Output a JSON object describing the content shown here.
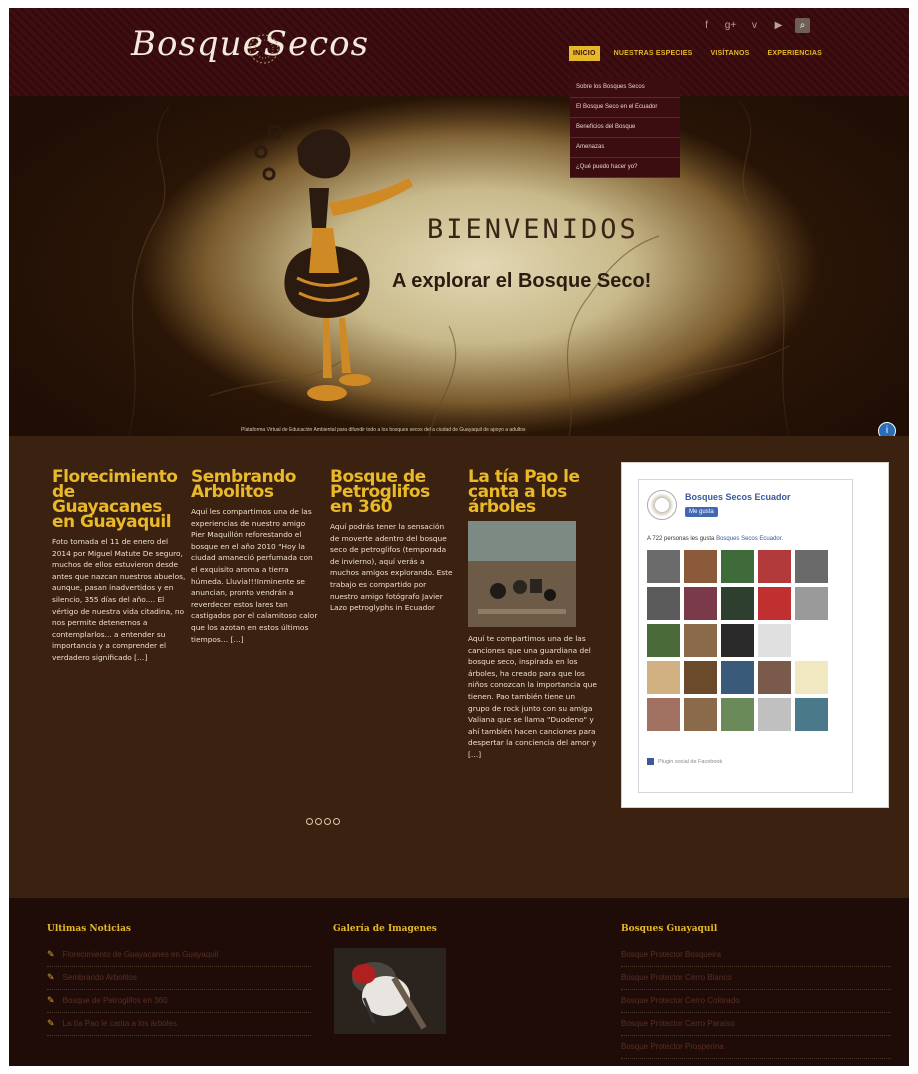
{
  "header": {
    "logo": "BosqueSecos",
    "social_icons": [
      "facebook-icon",
      "google-plus-icon",
      "vimeo-icon",
      "youtube-icon",
      "search-icon"
    ],
    "nav": [
      {
        "label": "INICIO",
        "active": true
      },
      {
        "label": "NUESTRAS ESPECIES",
        "active": false
      },
      {
        "label": "VISÍTANOS",
        "active": false
      },
      {
        "label": "EXPERIENCIAS",
        "active": false
      }
    ],
    "dropdown": [
      "Sobre los Bosques Secos",
      "El Bosque Seco en el Ecuador",
      "Beneficios del Bosque",
      "Amenazas",
      "¿Qué puedo hacer yo?"
    ]
  },
  "hero": {
    "title": "BIENVENIDOS",
    "subtitle": "A explorar el Bosque Seco!",
    "caption": "Plataforma Virtual de Educación Ambiental para difundir todo a los bosques secos del a ciudad de Guayaquil de apoyo a adultos"
  },
  "posts": [
    {
      "title": "Florecimiento de Guayacanes en Guayaquil",
      "body": "Foto tomada el 11 de enero del 2014 por Miguel Matute De seguro, muchos de ellos estuvieron desde antes que nazcan nuestros abuelos, aunque, pasan inadvertidos y en silencio, 355 días del año.... El vértigo de nuestra vida citadina, no nos permite detenernos a contemplarlos... a entender su importancia y a comprender el verdadero significado […]"
    },
    {
      "title": "Sembrando Arbolitos",
      "body": "Aquí les compartimos una de las experiencias de nuestro amigo Pier Maquillón reforestando el bosque en el año 2010 \"Hoy la ciudad amaneció perfumada con el exquisito aroma a tierra húmeda. Lluvia!!!Inminente se anuncian, pronto vendrán a reverdecer estos lares tan castigados por el calamitoso calor que los azotan en estos últimos tiempos… […]"
    },
    {
      "title": "Bosque de Petroglifos en 360",
      "body": "Aquí podrás tener la sensación de moverte adentro del bosque seco de petroglifos (temporada de invierno), aquí verás a muchos amigos explorando. Este trabajo es compartido por nuestro amigo fotógrafo Javier Lazo petroglyphs in Ecuador"
    },
    {
      "title": "La tía Pao le canta a los árboles",
      "body": "Aquí te compartimos una de las canciones que una guardiana del bosque seco, inspirada en los árboles, ha creado para que los niños conozcan la importancia que tienen. Pao también tiene un grupo de rock junto con su amiga Valiana que se llama \"Duodeno\" y ahí también hacen canciones para despertar la conciencia del amor y […]"
    }
  ],
  "facebook": {
    "page_name": "Bosques Secos Ecuador",
    "like_label": "Me gusta",
    "count_text": "A 722 personas les gusta",
    "count_link": "Bosques Secos Ecuador.",
    "plugin_label": "Plugin social de Facebook",
    "thumb_colors": [
      "#6b6b6b",
      "#8a5a3a",
      "#3f6b3a",
      "#b23a3a",
      "#6a6a6a",
      "#5a5a5a",
      "#7a3a4a",
      "#2f3f2f",
      "#c03030",
      "#9a9a9a",
      "#4a6a3a",
      "#8a6a4a",
      "#2a2a2a",
      "#e0e0e0",
      "#ffffff",
      "#d0b080",
      "#6a4a2a",
      "#3a5a7a",
      "#7a5a4a",
      "#f0e8c0",
      "#a07060",
      "#8a6a4a",
      "#6a8a5a",
      "#c0c0c0",
      "#4a7a8a"
    ]
  },
  "footer": {
    "news_title": "Ultimas Noticias",
    "news": [
      "Florecimiento de Guayacanes en Guayaquil",
      "Sembrando Arbolitos",
      "Bosque de Petroglifos en 360",
      "La tía Pao le canta a los árboles"
    ],
    "gallery_title": "Galería de Imagenes",
    "links_title": "Bosques Guayaquil",
    "links": [
      "Bosque Protector Bosqueira",
      "Bosque Protector Cerro Blanco",
      "Bosque Protector Cerro Colorado",
      "Bosque Protector Cerro Paraíso",
      "Bosque Protector Prosperina"
    ]
  }
}
